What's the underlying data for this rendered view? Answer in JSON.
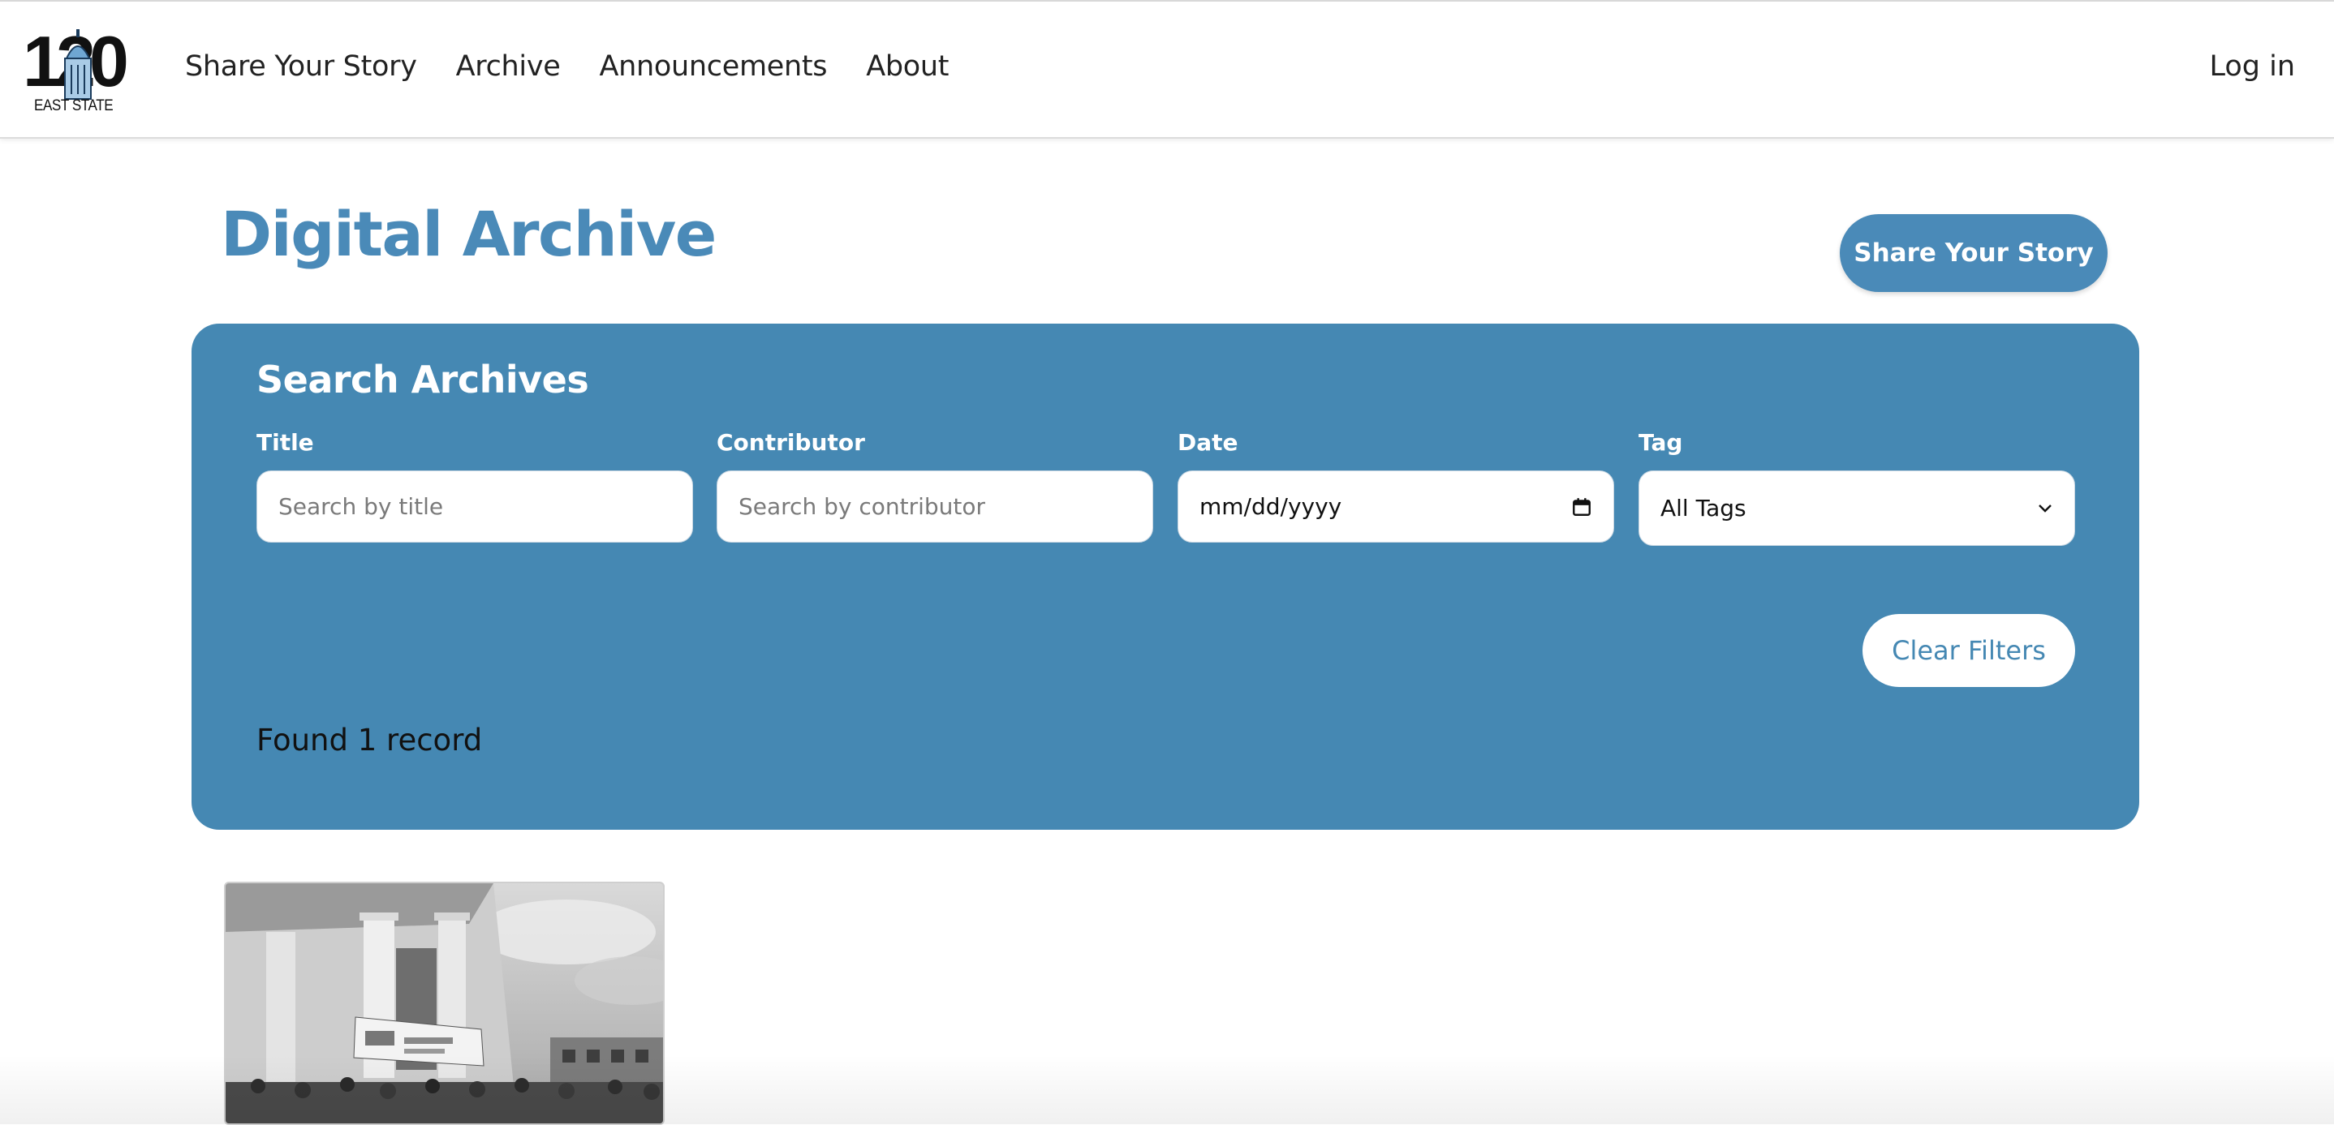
{
  "nav": {
    "logo_number": "120",
    "logo_text": "EAST STATE",
    "links": [
      {
        "label": "Share Your Story"
      },
      {
        "label": "Archive"
      },
      {
        "label": "Announcements"
      },
      {
        "label": "About"
      }
    ],
    "login_label": "Log in"
  },
  "header": {
    "title": "Digital Archive",
    "share_button_label": "Share Your Story"
  },
  "search": {
    "heading": "Search Archives",
    "title_field": {
      "label": "Title",
      "placeholder": "Search by title",
      "value": ""
    },
    "contributor_field": {
      "label": "Contributor",
      "placeholder": "Search by contributor",
      "value": ""
    },
    "date_field": {
      "label": "Date",
      "value": "mm/dd/yyyy",
      "icon": "calendar-icon"
    },
    "tag_field": {
      "label": "Tag",
      "selected": "All Tags",
      "icon": "chevron-down-icon"
    },
    "clear_button_label": "Clear Filters",
    "results_text": "Found 1 record"
  },
  "colors": {
    "accent": "#4a8ab8",
    "panel": "#4588b3",
    "text": "#222222"
  },
  "results": [
    {
      "thumbnail": "black-and-white photo of a columned building with a banner and crowd"
    }
  ]
}
